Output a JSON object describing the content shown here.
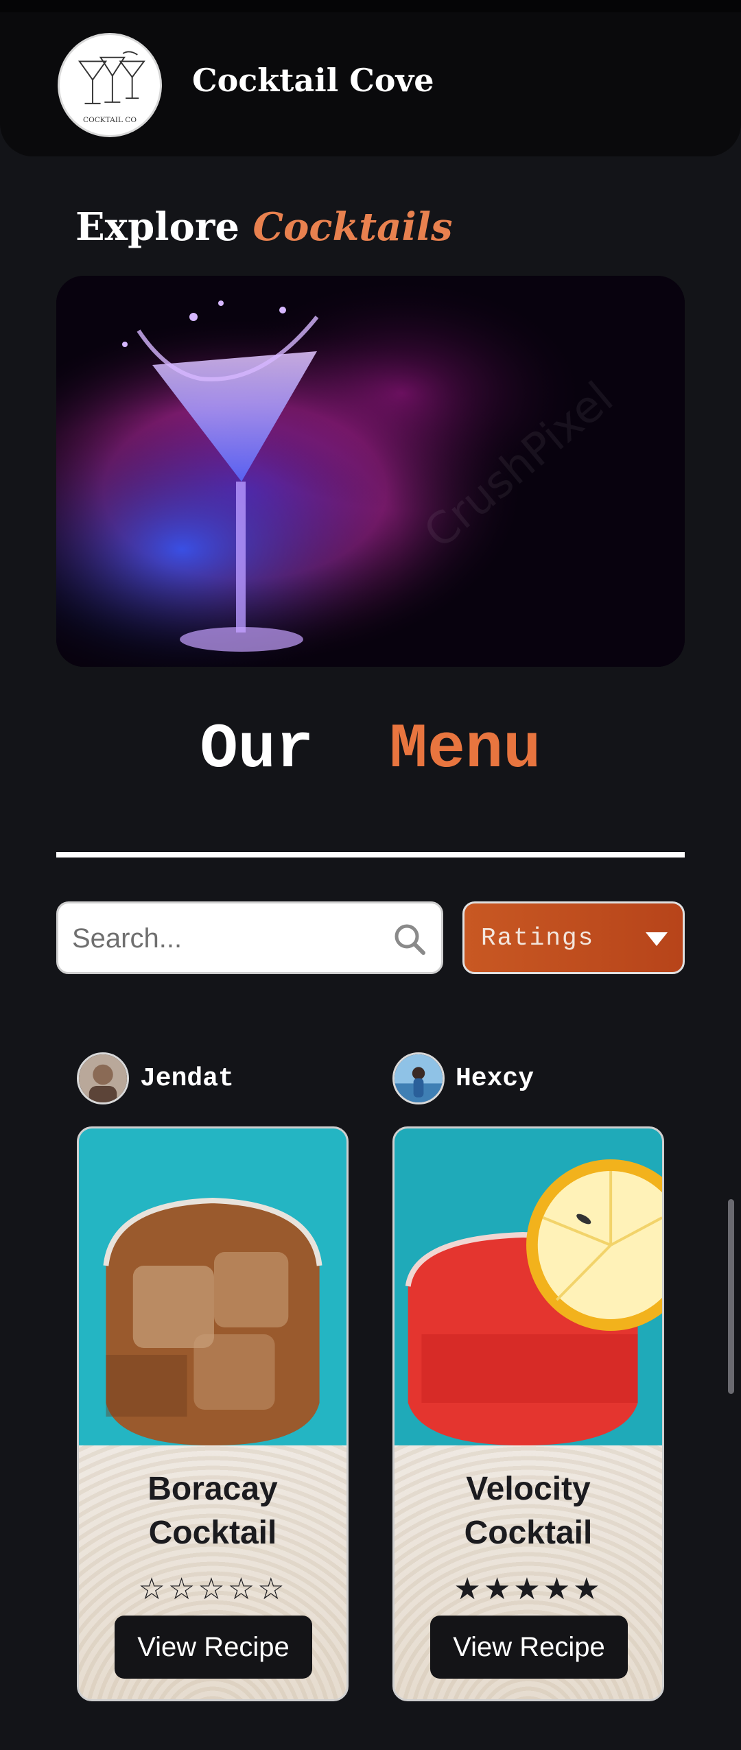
{
  "header": {
    "brand": "Cocktail Cove",
    "logo_text": "COCKTAIL CO"
  },
  "explore": {
    "prefix": "Explore",
    "accent": "Cocktails"
  },
  "hero": {
    "watermark": "CrushPixel"
  },
  "menu": {
    "word1": "Our",
    "word2": "Menu"
  },
  "filters": {
    "search_placeholder": "Search...",
    "ratings_label": "Ratings"
  },
  "cards": [
    {
      "author": "Jendat",
      "title_line1": "Boracay",
      "title_line2": "Cocktail",
      "rating": 0,
      "max_rating": 5,
      "button": "View Recipe"
    },
    {
      "author": "Hexcy",
      "title_line1": "Velocity",
      "title_line2": "Cocktail",
      "rating": 5,
      "max_rating": 5,
      "button": "View Recipe"
    }
  ],
  "colors": {
    "background": "#131418",
    "accent": "#e8814f",
    "ratings_bg": "#c85823",
    "button_bg": "#141417"
  }
}
